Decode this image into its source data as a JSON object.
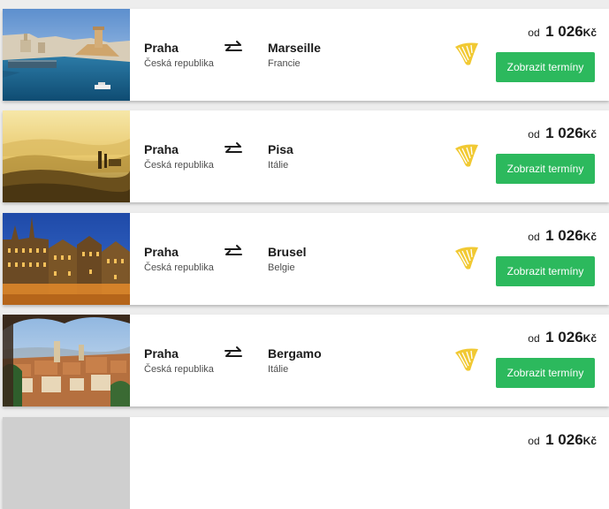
{
  "routes": [
    {
      "origin": {
        "city": "Praha",
        "country": "Česká republika"
      },
      "destination": {
        "city": "Marseille",
        "country": "Francie"
      },
      "price": {
        "from": "od",
        "amount": "1 026",
        "currency": "Kč"
      },
      "cta": "Zobrazit termíny",
      "image": "marseille-harbour-photo",
      "airline_icon": "ryanair-harp-logo"
    },
    {
      "origin": {
        "city": "Praha",
        "country": "Česká republika"
      },
      "destination": {
        "city": "Pisa",
        "country": "Itálie"
      },
      "price": {
        "from": "od",
        "amount": "1 026",
        "currency": "Kč"
      },
      "cta": "Zobrazit termíny",
      "image": "tuscany-misty-hills-photo",
      "airline_icon": "ryanair-harp-logo"
    },
    {
      "origin": {
        "city": "Praha",
        "country": "Česká republika"
      },
      "destination": {
        "city": "Brusel",
        "country": "Belgie"
      },
      "price": {
        "from": "od",
        "amount": "1 026",
        "currency": "Kč"
      },
      "cta": "Zobrazit termíny",
      "image": "brussels-grand-place-photo",
      "airline_icon": "ryanair-harp-logo"
    },
    {
      "origin": {
        "city": "Praha",
        "country": "Česká republika"
      },
      "destination": {
        "city": "Bergamo",
        "country": "Itálie"
      },
      "price": {
        "from": "od",
        "amount": "1 026",
        "currency": "Kč"
      },
      "cta": "Zobrazit termíny",
      "image": "bergamo-rooftops-photo",
      "airline_icon": "ryanair-harp-logo"
    },
    {
      "price": {
        "from": "od",
        "amount": "1 026",
        "currency": "Kč"
      },
      "image": "placeholder-photo"
    }
  ],
  "colors": {
    "cta_green": "#2cb95d",
    "airline_yellow": "#f1c933",
    "background": "#ededed"
  },
  "icons": {
    "swap": "swap-arrows-icon",
    "airline": "ryanair-harp-logo"
  }
}
